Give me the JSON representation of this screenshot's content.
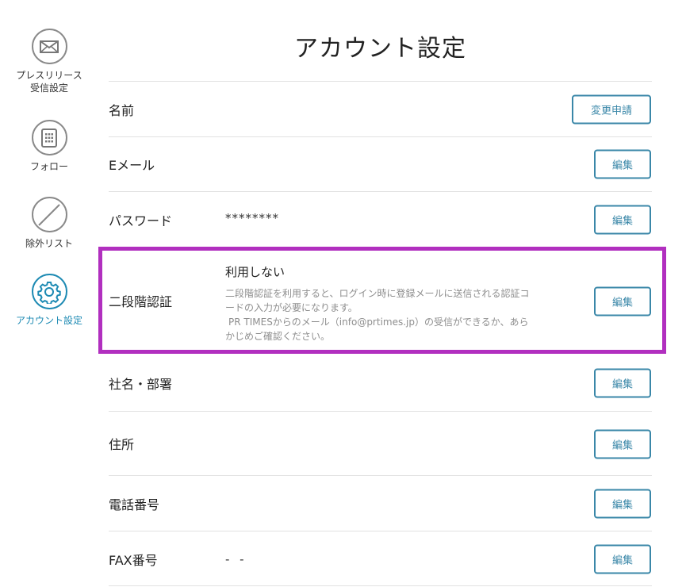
{
  "sidebar": {
    "items": [
      {
        "label_line1": "プレスリリース",
        "label_line2": "受信設定",
        "icon": "envelope-icon"
      },
      {
        "label": "フォロー",
        "icon": "building-icon"
      },
      {
        "label": "除外リスト",
        "icon": "no-entry-icon"
      },
      {
        "label": "アカウント設定",
        "icon": "gear-icon",
        "active": true
      }
    ],
    "active_color": "#1d8ab3"
  },
  "page": {
    "title": "アカウント設定"
  },
  "rows": {
    "name": {
      "label": "名前",
      "button": "変更申請"
    },
    "email": {
      "label": "Eメール",
      "button": "編集"
    },
    "password": {
      "label": "パスワード",
      "value": "********",
      "button": "編集"
    },
    "two_factor": {
      "label": "二段階認証",
      "status": "利用しない",
      "desc_line1": "二段階認証を利用すると、ログイン時に登録メールに送信される認証コ",
      "desc_line2": "ードの入力が必要になります。",
      "desc_line3": "PR TIMESからのメール（info@prtimes.jp）の受信ができるか、あら",
      "desc_line4": "かじめご確認ください。",
      "button": "編集"
    },
    "company": {
      "label": "社名・部署",
      "button": "編集"
    },
    "address": {
      "label": "住所",
      "button": "編集"
    },
    "phone": {
      "label": "電話番号",
      "button": "編集"
    },
    "fax": {
      "label": "FAX番号",
      "value": "- -",
      "button": "編集"
    }
  },
  "colors": {
    "highlight": "#b12fbf",
    "button_border": "#3a87a8"
  }
}
